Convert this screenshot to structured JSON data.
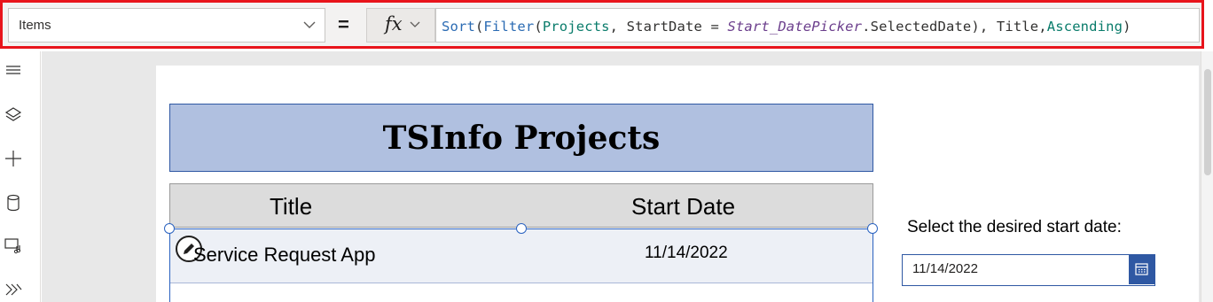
{
  "formula_bar": {
    "property": "Items",
    "equals": "=",
    "fx": "fx",
    "formula_tokens": [
      {
        "text": "Sort",
        "kind": "fn"
      },
      {
        "text": "(",
        "kind": "plain"
      },
      {
        "text": "Filter",
        "kind": "fn"
      },
      {
        "text": "(",
        "kind": "plain"
      },
      {
        "text": "Projects",
        "kind": "ds"
      },
      {
        "text": ", StartDate = ",
        "kind": "plain"
      },
      {
        "text": "Start_DatePicker",
        "kind": "ctl"
      },
      {
        "text": ".SelectedDate), Title,",
        "kind": "plain"
      },
      {
        "text": "Ascending",
        "kind": "en"
      },
      {
        "text": ")",
        "kind": "plain"
      }
    ],
    "highlight_color": "#e8141b"
  },
  "rail": {
    "icons": [
      "menu-icon",
      "layers-icon",
      "add-icon",
      "data-icon",
      "media-icon",
      "flows-icon"
    ]
  },
  "canvas": {
    "title": "TSInfo Projects",
    "title_color": "#b0c0e0",
    "headers": {
      "title": "Title",
      "start_date": "Start Date"
    },
    "rows": [
      {
        "title": "Service Request App",
        "start_date": "11/14/2022"
      }
    ],
    "picker_label": "Select the desired start date:",
    "picker_value": "11/14/2022",
    "accent": "#2f58a3"
  }
}
